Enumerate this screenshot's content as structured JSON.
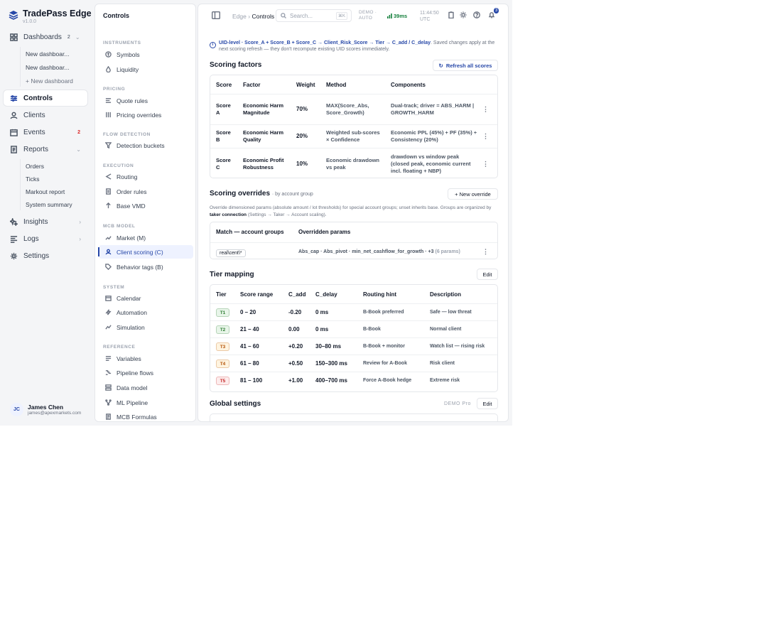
{
  "brand": {
    "name": "TradePass Edge",
    "version": "v1.0.0"
  },
  "sidebar": {
    "dashboards": {
      "label": "Dashboards",
      "count": "2",
      "items": [
        "New dashboar...",
        "New dashboar...",
        "+ New dashboard"
      ]
    },
    "controls": "Controls",
    "clients": "Clients",
    "events": {
      "label": "Events",
      "count": "2"
    },
    "reports": {
      "label": "Reports",
      "items": [
        "Orders",
        "Ticks",
        "Markout report",
        "System summary"
      ]
    },
    "insights": "Insights",
    "logs": "Logs",
    "settings": "Settings"
  },
  "user": {
    "initials": "JC",
    "name": "James Chen",
    "email": "james@apexmarkets.com"
  },
  "controls": {
    "title": "Controls",
    "sections": [
      {
        "title": "INSTRUMENTS",
        "items": [
          "Symbols",
          "Liquidity"
        ]
      },
      {
        "title": "PRICING",
        "items": [
          "Quote rules",
          "Pricing overrides"
        ]
      },
      {
        "title": "FLOW DETECTION",
        "items": [
          "Detection buckets"
        ]
      },
      {
        "title": "EXECUTION",
        "items": [
          "Routing",
          "Order rules",
          "Base VMD"
        ]
      },
      {
        "title": "MCB MODEL",
        "items": [
          "Market (M)",
          "Client scoring (C)",
          "Behavior tags (B)"
        ]
      },
      {
        "title": "SYSTEM",
        "items": [
          "Calendar",
          "Automation",
          "Simulation"
        ]
      },
      {
        "title": "REFERENCE",
        "items": [
          "Variables",
          "Pipeline flows",
          "Data model",
          "ML Pipeline",
          "MCB Formulas"
        ]
      }
    ]
  },
  "topbar": {
    "crumb_root": "Edge",
    "crumb_sep": "›",
    "crumb_current": "Controls",
    "search_placeholder": "Search...",
    "shortcut": "⌘K",
    "mode_line1": "DEMO ·",
    "mode_line2": "AUTO",
    "latency": "39ms",
    "time": "11:44:50",
    "tz": "UTC",
    "notifications": "3"
  },
  "info": {
    "formula": "UID-level · Score_A + Score_B + Score_C → Client_Risk_Score → Tier → C_add / C_delay",
    "text": ". Saved changes apply at the next scoring refresh — they don't recompute existing UID scores immediately."
  },
  "scoring": {
    "title": "Scoring factors",
    "refresh": "Refresh all scores",
    "headers": [
      "Score",
      "Factor",
      "Weight",
      "Method",
      "Components"
    ],
    "rows": [
      {
        "score": "Score A",
        "factor": "Economic Harm Magnitude",
        "weight": "70%",
        "method": "MAX(Score_Abs, Score_Growth)",
        "components": "Dual-track; driver = ABS_HARM | GROWTH_HARM"
      },
      {
        "score": "Score B",
        "factor": "Economic Harm Quality",
        "weight": "20%",
        "method": "Weighted sub-scores × Confidence",
        "components": "Economic PPL (45%) + PF (35%) + Consistency (20%)"
      },
      {
        "score": "Score C",
        "factor": "Economic Profit Robustness",
        "weight": "10%",
        "method": "Economic drawdown vs peak",
        "components": "drawdown vs window peak (closed peak, economic current incl. floating + NBP)"
      }
    ]
  },
  "overrides": {
    "title": "Scoring overrides",
    "subtitle": "· by account group",
    "new": "+ New override",
    "note_a": "Override dimensioned params (absolute amount / lot thresholds) for special account groups; unset inherits base. Groups are organized by ",
    "note_b": "taker connection",
    "note_c": " (Settings → Taker → Account scaling).",
    "headers": [
      "Match — account groups",
      "Overridden params"
    ],
    "row": {
      "match": "real\\cent\\*",
      "params": "Abs_cap · Abs_pivot · min_net_cashflow_for_growth · +3",
      "count": "(6 params)"
    }
  },
  "tiers": {
    "title": "Tier mapping",
    "edit": "Edit",
    "headers": [
      "Tier",
      "Score range",
      "C_add",
      "C_delay",
      "Routing hint",
      "Description"
    ],
    "rows": [
      {
        "tier": "T1",
        "range": "0 – 20",
        "add": "-0.20",
        "delay": "0 ms",
        "hint": "B-Book preferred",
        "desc": "Safe — low threat",
        "bg": "#e8f5e9",
        "fg": "#2e7d32"
      },
      {
        "tier": "T2",
        "range": "21 – 40",
        "add": "0.00",
        "delay": "0 ms",
        "hint": "B-Book",
        "desc": "Normal client",
        "bg": "#e8f5e9",
        "fg": "#2e7d32"
      },
      {
        "tier": "T3",
        "range": "41 – 60",
        "add": "+0.20",
        "delay": "30–80 ms",
        "hint": "B-Book + monitor",
        "desc": "Watch list — rising risk",
        "bg": "#fff4e0",
        "fg": "#b45309"
      },
      {
        "tier": "T4",
        "range": "61 – 80",
        "add": "+0.50",
        "delay": "150–300 ms",
        "hint": "Review for A-Book",
        "desc": "Risk client",
        "bg": "#fff4e0",
        "fg": "#b45309"
      },
      {
        "tier": "T5",
        "range": "81 – 100",
        "add": "+1.00",
        "delay": "400–700 ms",
        "hint": "Force A-Book hedge",
        "desc": "Extreme risk",
        "bg": "#fdecec",
        "fg": "#c62828"
      }
    ]
  },
  "global": {
    "title": "Global settings",
    "tag": "DEMO Pro",
    "edit": "Edit"
  }
}
